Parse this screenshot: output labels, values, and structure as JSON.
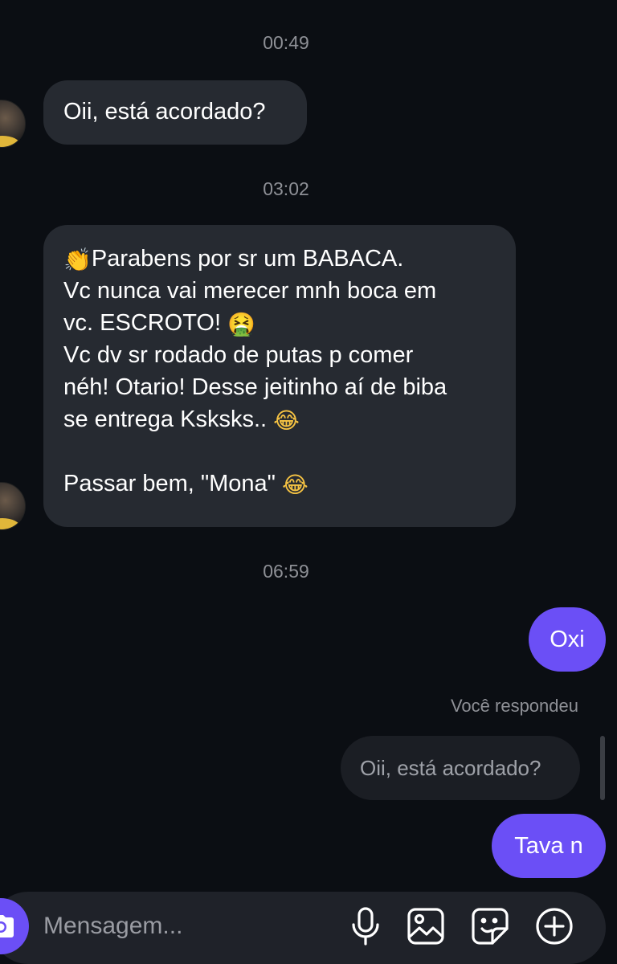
{
  "timestamps": [
    "00:49",
    "03:02",
    "06:59"
  ],
  "messages": {
    "m1": {
      "text": "Oii, está acordado?"
    },
    "m2": {
      "line1": "Parabens por sr um BABACA.",
      "line2": "Vc nunca vai merecer mnh boca em",
      "line3": "vc. ESCROTO! ",
      "line4": "Vc dv sr rodado de putas p comer",
      "line5": "néh! Otario! Desse jeitinho aí de biba",
      "line6": "se entrega Ksksks.. ",
      "line7": "Passar bem, \"Mona\" ",
      "emojis": {
        "clap": "👏",
        "vomit": "🤮",
        "laugh": "😂"
      }
    },
    "m3": {
      "text": "Oxi"
    },
    "reply": {
      "label": "Você respondeu",
      "quoted": "Oii, está acordado?"
    },
    "m4": {
      "text": "Tava n"
    }
  },
  "composer": {
    "placeholder": "Mensagem...",
    "icons": [
      "camera-icon",
      "microphone-icon",
      "image-icon",
      "sticker-icon",
      "add-icon"
    ]
  },
  "colors": {
    "background": "#0b0e13",
    "incoming_bubble": "#262a31",
    "outgoing_bubble": "#6b4ff6",
    "quoted_bubble": "#1b1e24",
    "timestamp_text": "#8e9096"
  }
}
